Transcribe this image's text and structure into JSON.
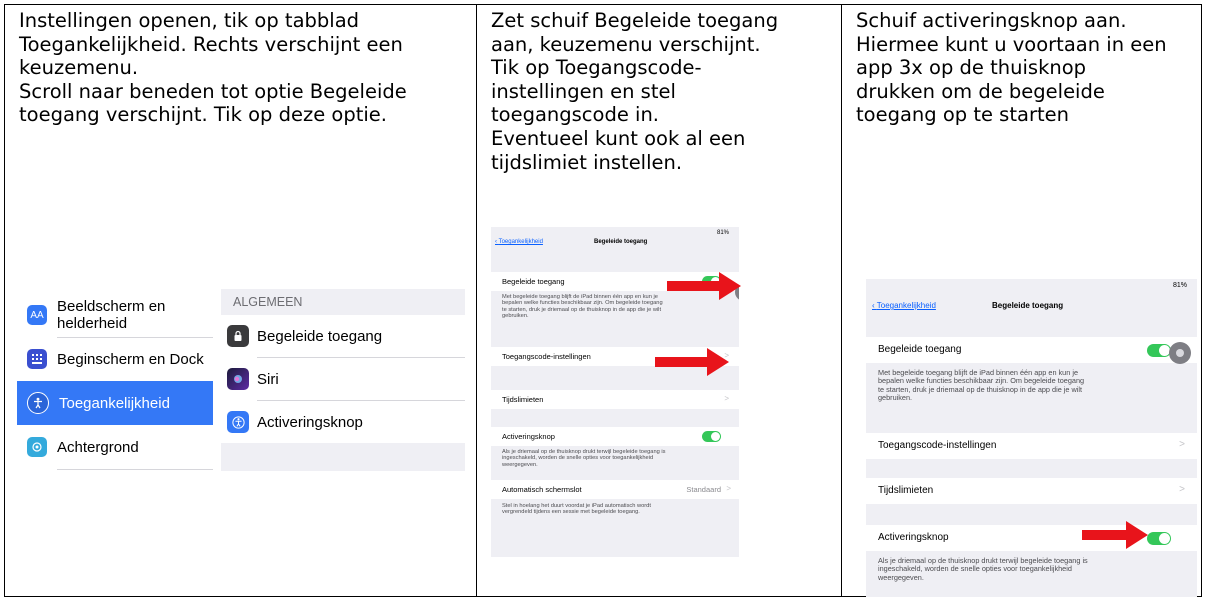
{
  "step1": {
    "lines": [
      "Instellingen openen, tik op tabblad",
      "Toegankelijkheid. Rechts verschijnt een",
      "keuzemenu.",
      "Scroll naar beneden tot optie Begeleide",
      "toegang verschijnt. Tik op deze optie."
    ],
    "sidebar": [
      {
        "label": "Beeldscherm en helderheid",
        "icon": "display-brightness-icon",
        "color": "#3478f6"
      },
      {
        "label": "Beginscherm en Dock",
        "icon": "home-screen-icon",
        "color": "#3a4fd0"
      },
      {
        "label": "Toegankelijkheid",
        "icon": "accessibility-icon",
        "color": "#3478f6"
      },
      {
        "label": "Achtergrond",
        "icon": "wallpaper-icon",
        "color": "#34aadc"
      }
    ],
    "detail": {
      "section_header": "ALGEMEEN",
      "items": [
        {
          "label": "Begeleide toegang",
          "icon": "lock-icon",
          "color": "#3a3a3c"
        },
        {
          "label": "Siri",
          "icon": "siri-icon",
          "color": "#5e2ca5"
        },
        {
          "label": "Activeringsknop",
          "icon": "accessibility-icon",
          "color": "#3478f6"
        }
      ]
    }
  },
  "step2": {
    "lines": [
      "Zet schuif Begeleide toegang",
      "aan, keuzemenu verschijnt.",
      "Tik op Toegangscode-",
      "instellingen en stel",
      "toegangscode in.",
      "Eventueel kunt ook al een",
      "tijdslimiet instellen."
    ]
  },
  "step3": {
    "lines": [
      "Schuif activeringsknop aan.",
      "Hiermee kunt u voortaan in een",
      "app 3x op de thuisknop",
      "drukken om de begeleide",
      "toegang op te starten"
    ]
  },
  "ipad": {
    "status": "81%",
    "back_label": "Toegankelijkheid",
    "nav_title": "Begeleide toegang",
    "guided_access_label": "Begeleide toegang",
    "guided_access_footer": [
      "Met begeleide toegang blijft de iPad binnen één app en kun je",
      "bepalen welke functies beschikbaar zijn. Om begeleide toegang",
      "te starten, druk je driemaal op de thuisknop in de app die je wilt",
      "gebruiken."
    ],
    "passcode_label": "Toegangscode-instellingen",
    "time_limits_label": "Tijdslimieten",
    "shortcut_label": "Activeringsknop",
    "shortcut_footer": [
      "Als je driemaal op de thuisknop drukt terwijl begeleide toegang is",
      "ingeschakeld, worden de snelle opties voor toegankelijkheid",
      "weergegeven."
    ],
    "autolock_label": "Automatisch schermslot",
    "autolock_value": "Standaard",
    "autolock_footer": [
      "Stel in hoelang het duurt voordat je iPad automatisch wordt",
      "vergrendeld tijdens een sessie met begeleide toegang."
    ],
    "chevron": ">",
    "colors": {
      "toggle_on": "#34c759",
      "arrow": "#e8141b",
      "link": "#0a60ff",
      "selected": "#3478f6"
    }
  }
}
